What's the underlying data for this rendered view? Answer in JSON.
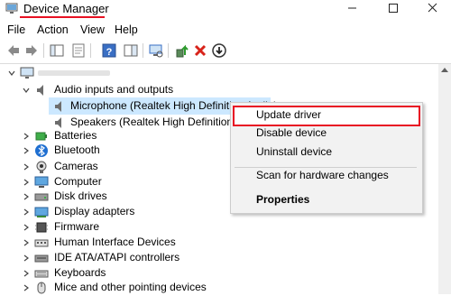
{
  "window": {
    "title": "Device Manager",
    "controls": {
      "minimize": "minimize-icon",
      "maximize": "maximize-icon",
      "close": "close-icon"
    }
  },
  "menubar": {
    "file": "File",
    "action": "Action",
    "view": "View",
    "help": "Help"
  },
  "toolbar": {
    "icons": [
      "back-arrow-icon",
      "forward-arrow-icon",
      "show-hide-tree-icon",
      "properties-icon",
      "help-icon",
      "action-pane-icon",
      "scan-hardware-icon",
      "update-driver-icon",
      "uninstall-icon",
      "disable-device-icon"
    ]
  },
  "tree": {
    "audio": {
      "label": "Audio inputs and outputs",
      "children": [
        "Microphone (Realtek High Definition Audio)",
        "Speakers (Realtek High Definition Audio)"
      ]
    },
    "categories": [
      "Batteries",
      "Bluetooth",
      "Cameras",
      "Computer",
      "Disk drives",
      "Display adapters",
      "Firmware",
      "Human Interface Devices",
      "IDE ATA/ATAPI controllers",
      "Keyboards",
      "Mice and other pointing devices"
    ]
  },
  "context_menu": {
    "items": [
      "Update driver",
      "Disable device",
      "Uninstall device",
      "Scan for hardware changes",
      "Properties"
    ],
    "highlighted": "Update driver"
  },
  "colors": {
    "highlight_border": "#e81123",
    "selection": "#cce8ff",
    "menu_bg": "#f2f2f2"
  }
}
